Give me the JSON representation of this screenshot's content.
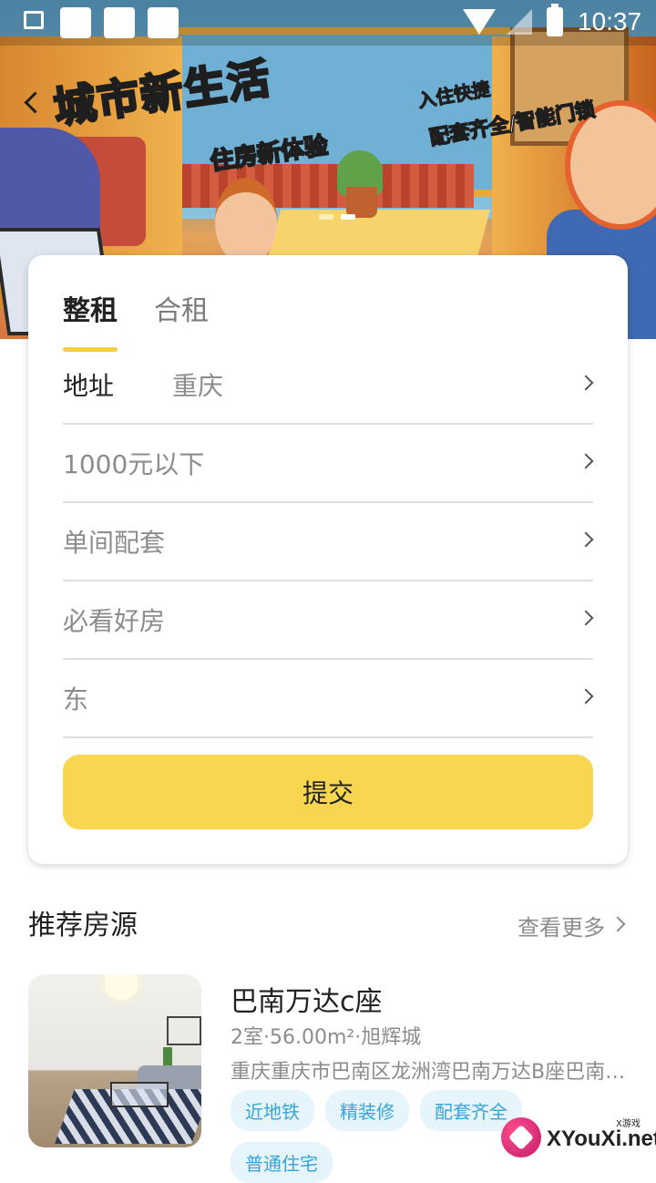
{
  "status_bar": {
    "time": "10:37"
  },
  "banner": {
    "slogan_main": "城市新生活",
    "slogan_sub": "住房新体验",
    "slogan_right_1": "入住快捷",
    "slogan_right_2": "配套齐全/智能门锁",
    "page_indicator": {
      "count": 2,
      "active": 1
    }
  },
  "search_card": {
    "tabs": [
      {
        "label": "整租",
        "active": true
      },
      {
        "label": "合租",
        "active": false
      }
    ],
    "address_label": "地址",
    "address_value": "重庆",
    "price_value": "1000元以下",
    "facility_value": "单间配套",
    "feature_value": "必看好房",
    "orientation_value": "东",
    "submit_label": "提交"
  },
  "recommended": {
    "title": "推荐房源",
    "more_label": "查看更多",
    "listings": [
      {
        "title": "巴南万达c座",
        "meta": "2室·56.00m²·旭辉城",
        "address": "重庆重庆市巴南区龙洲湾巴南万达B座巴南万达",
        "tags": [
          "近地铁",
          "精装修",
          "配套齐全",
          "普通住宅"
        ]
      }
    ]
  },
  "watermark": {
    "text": "XYouXi.net",
    "sub": "X游戏"
  },
  "colors": {
    "accent_yellow": "#f9d64f",
    "tag_blue": "#37a3da",
    "tag_bg": "#e6f4fb"
  }
}
